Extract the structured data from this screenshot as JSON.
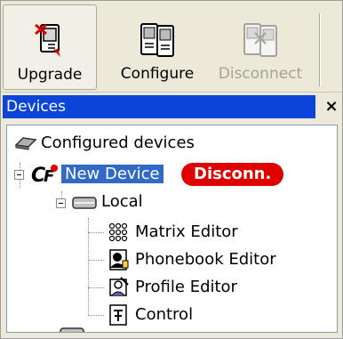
{
  "toolbar": {
    "buttons": [
      {
        "label": "Upgrade",
        "icon": "upgrade-icon",
        "enabled": true
      },
      {
        "label": "Configure",
        "icon": "configure-icon",
        "enabled": true
      },
      {
        "label": "Disconnect",
        "icon": "disconnect-icon",
        "enabled": false
      }
    ]
  },
  "devices_panel": {
    "title": "Devices",
    "close_label": "×"
  },
  "tree": {
    "root": {
      "label": "Configured devices",
      "icon": "network-icon"
    },
    "device": {
      "label": "New Device",
      "icon": "cf-device-icon",
      "status_badge": "Disconn.",
      "status_color": "#e00000"
    },
    "group": {
      "label": "Local",
      "icon": "local-drive-icon"
    },
    "items": [
      {
        "label": "Matrix Editor",
        "icon": "matrix-icon"
      },
      {
        "label": "Phonebook Editor",
        "icon": "phonebook-icon"
      },
      {
        "label": "Profile Editor",
        "icon": "profile-icon"
      },
      {
        "label": "Control",
        "icon": "control-icon"
      }
    ]
  },
  "colors": {
    "titlebar": "#0a44d8",
    "selection": "#3169c6",
    "window_bg": "#ece9d8"
  }
}
